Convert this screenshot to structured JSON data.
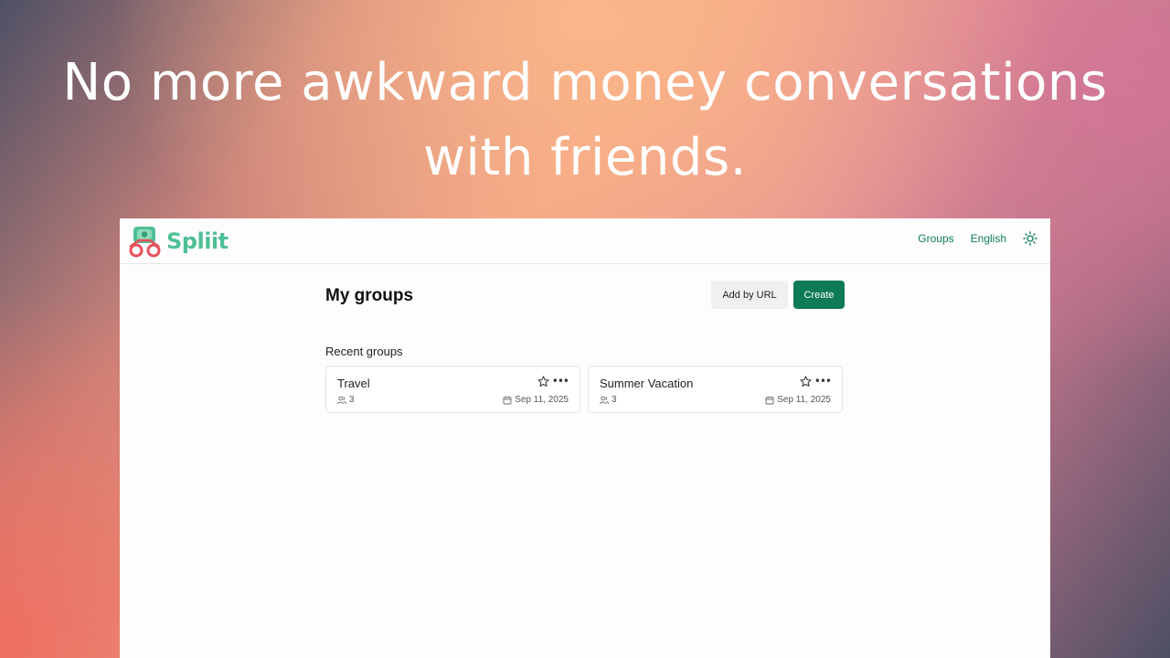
{
  "headline": {
    "line1": "No more awkward money conversations",
    "line2": "with friends."
  },
  "brand": {
    "name": "Spliit",
    "color": "#4fbf95",
    "logo_icon": "spliit-logo-icon"
  },
  "nav": {
    "groups_label": "Groups",
    "language_label": "English",
    "theme_icon": "sun-icon"
  },
  "page": {
    "title": "My groups",
    "add_by_url_label": "Add by URL",
    "create_label": "Create",
    "recent_label": "Recent groups"
  },
  "groups": [
    {
      "name": "Travel",
      "members": "3",
      "date": "Sep 11, 2025"
    },
    {
      "name": "Summer Vacation",
      "members": "3",
      "date": "Sep 11, 2025"
    }
  ],
  "colors": {
    "accent": "#0e7a56",
    "link": "#0f7a5a"
  }
}
